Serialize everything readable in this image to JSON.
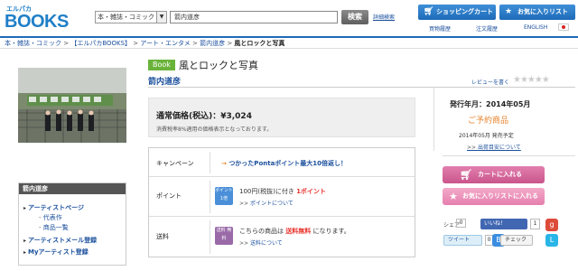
{
  "header": {
    "logo_small": "エルパカ",
    "logo_big": "BOOKS",
    "category": "本・雑誌・コミック",
    "search_value": "箭内道彦",
    "search_button": "検索",
    "advanced_search": "詳細検索",
    "cart_button": "ショッピングカート",
    "favorites_button": "お気に入りリスト",
    "links": [
      "買物履歴",
      "注文履歴",
      "ENGLISH"
    ]
  },
  "breadcrumb": {
    "items": [
      "本・雑誌・コミック",
      "【エルパカBOOKS】",
      "アート・エンタメ",
      "箭内道彦"
    ],
    "current": "風とロックと写真"
  },
  "product": {
    "badge": "Book",
    "title": "風とロックと写真",
    "author": "箭内道彦",
    "review_link": "レビューを書く",
    "stars": "★★★★★",
    "price_label": "通常価格(税込)：¥3,024",
    "price_note": "消費税率8%適用の価格表示となっております。"
  },
  "info": {
    "campaign_label": "キャンペーン",
    "campaign_text": "つかったPontaポイント最大10倍返し！",
    "point_label": "ポイント",
    "point_icon": "ポイント 1倍",
    "point_text_a": "100円(税抜)に付き",
    "point_text_b": "1ポイント",
    "point_link": "ポイントについて",
    "shipping_label": "送料",
    "shipping_icon": "送料 無料",
    "shipping_text_a": "こちらの商品は",
    "shipping_text_b": "送料無料",
    "shipping_text_c": "になります。",
    "shipping_link": "送料について"
  },
  "right": {
    "release": "発行年月：2014年05月",
    "status": "ご予約商品",
    "release_schedule": "2014年05月 発売予定",
    "ship_link": "出荷目安について",
    "add_cart": "カートに入れる",
    "add_fav": "お気に入りリストに入れる"
  },
  "social": {
    "share_label": "シェア",
    "share_count": "0",
    "fb_like": "いいね！",
    "fb_count": "1",
    "tweet": "ツイート",
    "tweet_count": "0",
    "mixi": "チェック"
  },
  "sidebar": {
    "title": "箭内道彦",
    "items": [
      "アーティストページ",
      "アーティストメール登録",
      "Myアーティスト登録"
    ],
    "subitems": [
      "代表作",
      "商品一覧"
    ]
  },
  "colors": {
    "brand_blue": "#1e6bb8",
    "pink": "#c9558c",
    "accent_orange": "#e8842f",
    "book_green": "#6ab33b"
  }
}
